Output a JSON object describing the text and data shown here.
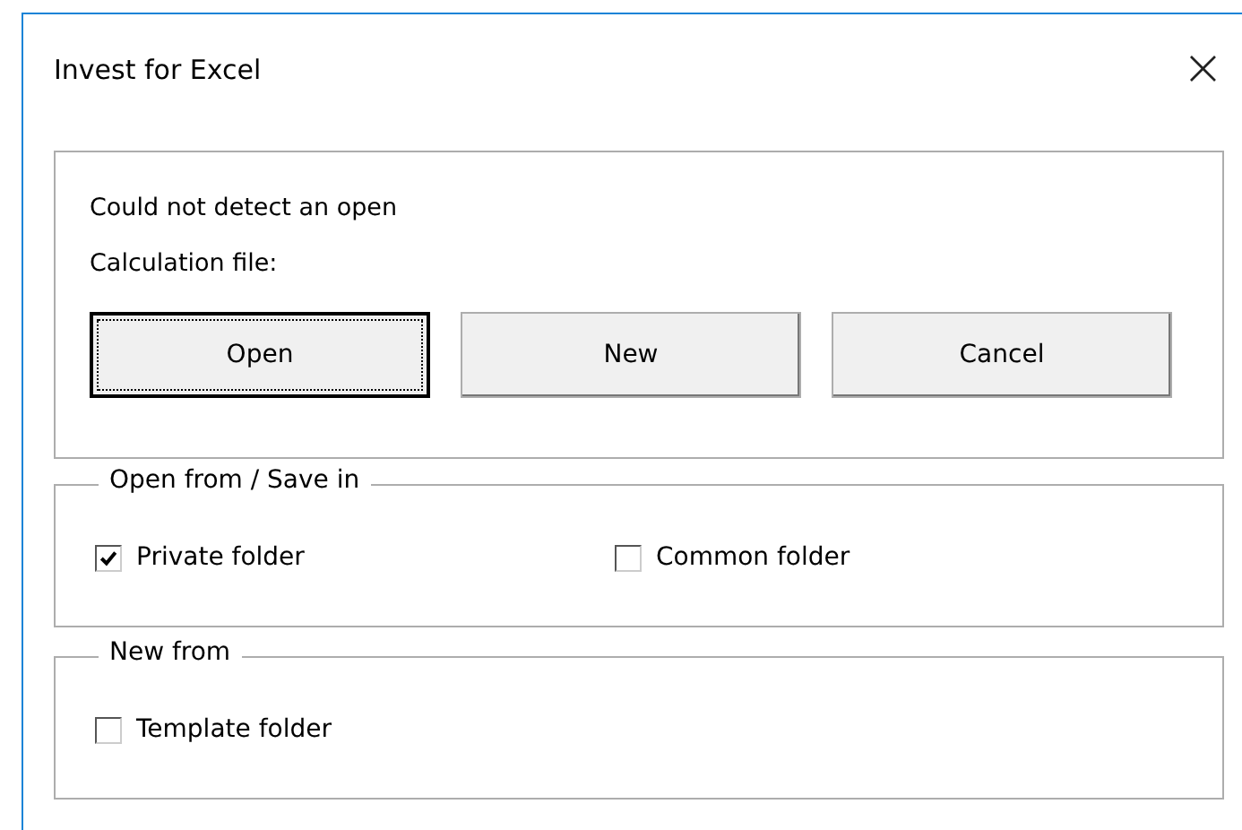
{
  "window": {
    "title": "Invest for Excel",
    "close": "×"
  },
  "message": {
    "lines": [
      "Could not detect an open",
      "Calculation file:"
    ]
  },
  "buttons": [
    {
      "label": "Open",
      "focused": true
    },
    {
      "label": "New",
      "focused": false
    },
    {
      "label": "Cancel",
      "focused": false
    }
  ],
  "groups": [
    {
      "legend": "Open from / Save in",
      "options": [
        {
          "label": "Private folder",
          "checked": true
        },
        {
          "label": "Common folder",
          "checked": false
        }
      ]
    },
    {
      "legend": "New from",
      "options": [
        {
          "label": "Template folder",
          "checked": false
        }
      ]
    }
  ]
}
